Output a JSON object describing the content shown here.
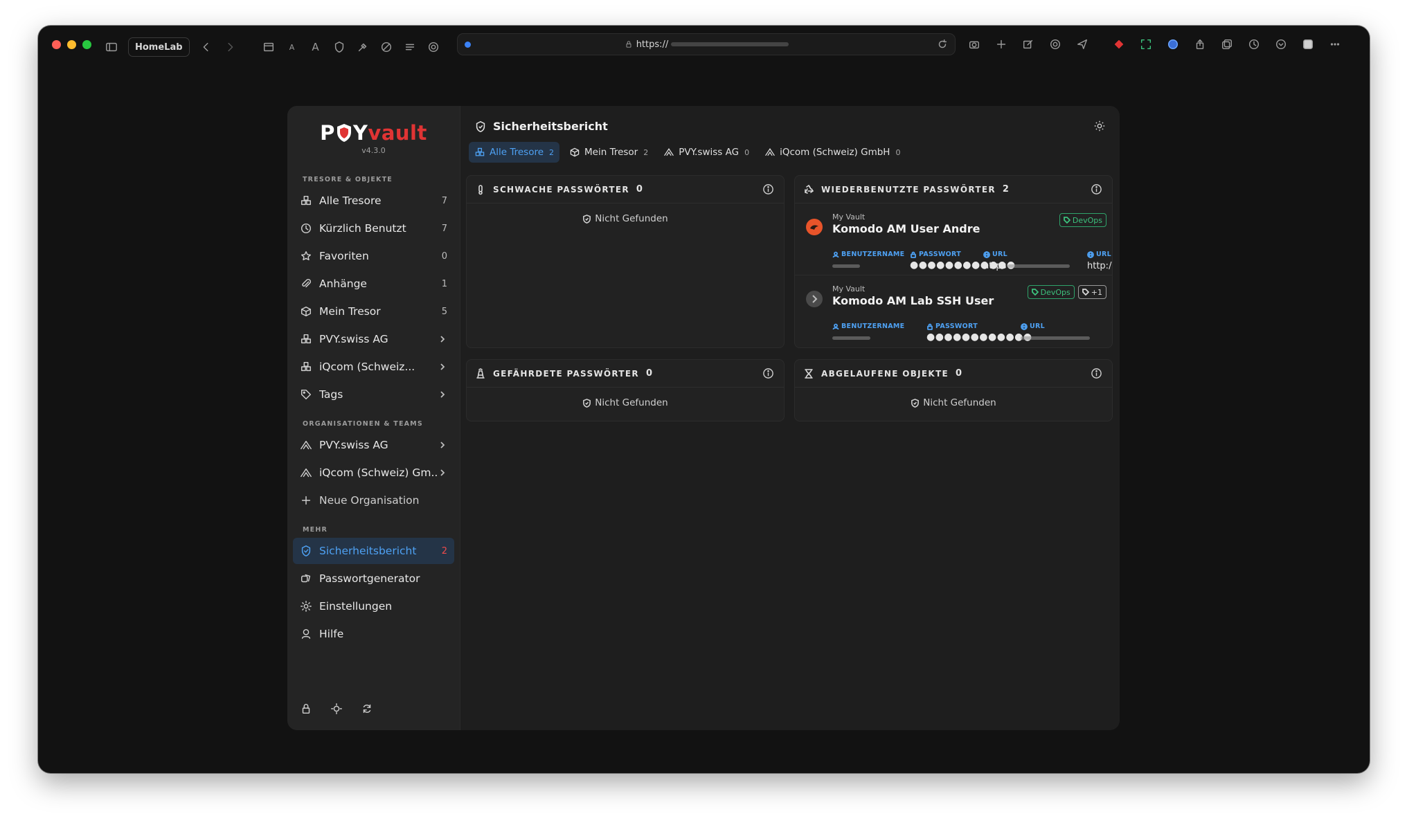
{
  "browser": {
    "tab_group": "HomeLab",
    "url": "https://"
  },
  "app": {
    "logo": {
      "part1": "P",
      "part2": "Y",
      "part3": "vault"
    },
    "version": "v4.3.0"
  },
  "sidebar": {
    "section_vaults": "TRESORE & OBJEKTE",
    "section_orgs": "ORGANISATIONEN & TEAMS",
    "section_more": "MEHR",
    "vault_items": [
      {
        "label": "Alle Tresore",
        "count": "7",
        "icon": "vaults-icon"
      },
      {
        "label": "Kürzlich Benutzt",
        "count": "7",
        "icon": "clock-icon"
      },
      {
        "label": "Favoriten",
        "count": "0",
        "icon": "star-icon"
      },
      {
        "label": "Anhänge",
        "count": "1",
        "icon": "paperclip-icon"
      },
      {
        "label": "Mein Tresor",
        "count": "5",
        "icon": "box-icon"
      },
      {
        "label": "PVY.swiss AG",
        "count": "",
        "icon": "vaults-icon"
      },
      {
        "label": "iQcom (Schweiz...",
        "count": "",
        "icon": "vaults-icon"
      },
      {
        "label": "Tags",
        "count": "",
        "icon": "tag-icon"
      }
    ],
    "org_items": [
      {
        "label": "PVY.swiss AG"
      },
      {
        "label": "iQcom (Schweiz) Gm..."
      },
      {
        "label": "Neue Organisation"
      }
    ],
    "more_items": [
      {
        "label": "Sicherheitsbericht",
        "count": "2"
      },
      {
        "label": "Passwortgenerator"
      },
      {
        "label": "Einstellungen"
      },
      {
        "label": "Hilfe"
      }
    ]
  },
  "main": {
    "title": "Sicherheitsbericht",
    "tabs": [
      {
        "label": "Alle Tresore",
        "count": "2"
      },
      {
        "label": "Mein Tresor",
        "count": "2"
      },
      {
        "label": "PVY.swiss AG",
        "count": "0"
      },
      {
        "label": "iQcom (Schweiz) GmbH",
        "count": "0"
      }
    ],
    "weak": {
      "title": "SCHWACHE PASSWÖRTER",
      "count": "0",
      "empty": "Nicht Gefunden"
    },
    "reused": {
      "title": "WIEDERBENUTZTE PASSWÖRTER",
      "count": "2",
      "entries": [
        {
          "vault": "My Vault",
          "name": "Komodo AM User Andre",
          "badges": [
            "DevOps"
          ],
          "user_label": "BENUTZERNAME",
          "pass_label": "PASSWORT",
          "pass_value": "●●●●●●●●●●●●",
          "url_label": "URL",
          "url_value": "https",
          "url2_label": "URL",
          "url2_value": "http:/"
        },
        {
          "vault": "My Vault",
          "name": "Komodo AM Lab SSH User",
          "badges": [
            "DevOps",
            "+1"
          ],
          "user_label": "BENUTZERNAME",
          "pass_label": "PASSWORT",
          "pass_value": "●●●●●●●●●●●●",
          "url_label": "URL"
        }
      ]
    },
    "exposed": {
      "title": "GEFÄHRDETE PASSWÖRTER",
      "count": "0",
      "empty": "Nicht Gefunden"
    },
    "expired": {
      "title": "ABGELAUFENE OBJEKTE",
      "count": "0",
      "empty": "Nicht Gefunden"
    }
  },
  "colors": {
    "accent": "#4ea1f3",
    "brand_red": "#e03434",
    "badge_green": "#3cc27d"
  }
}
